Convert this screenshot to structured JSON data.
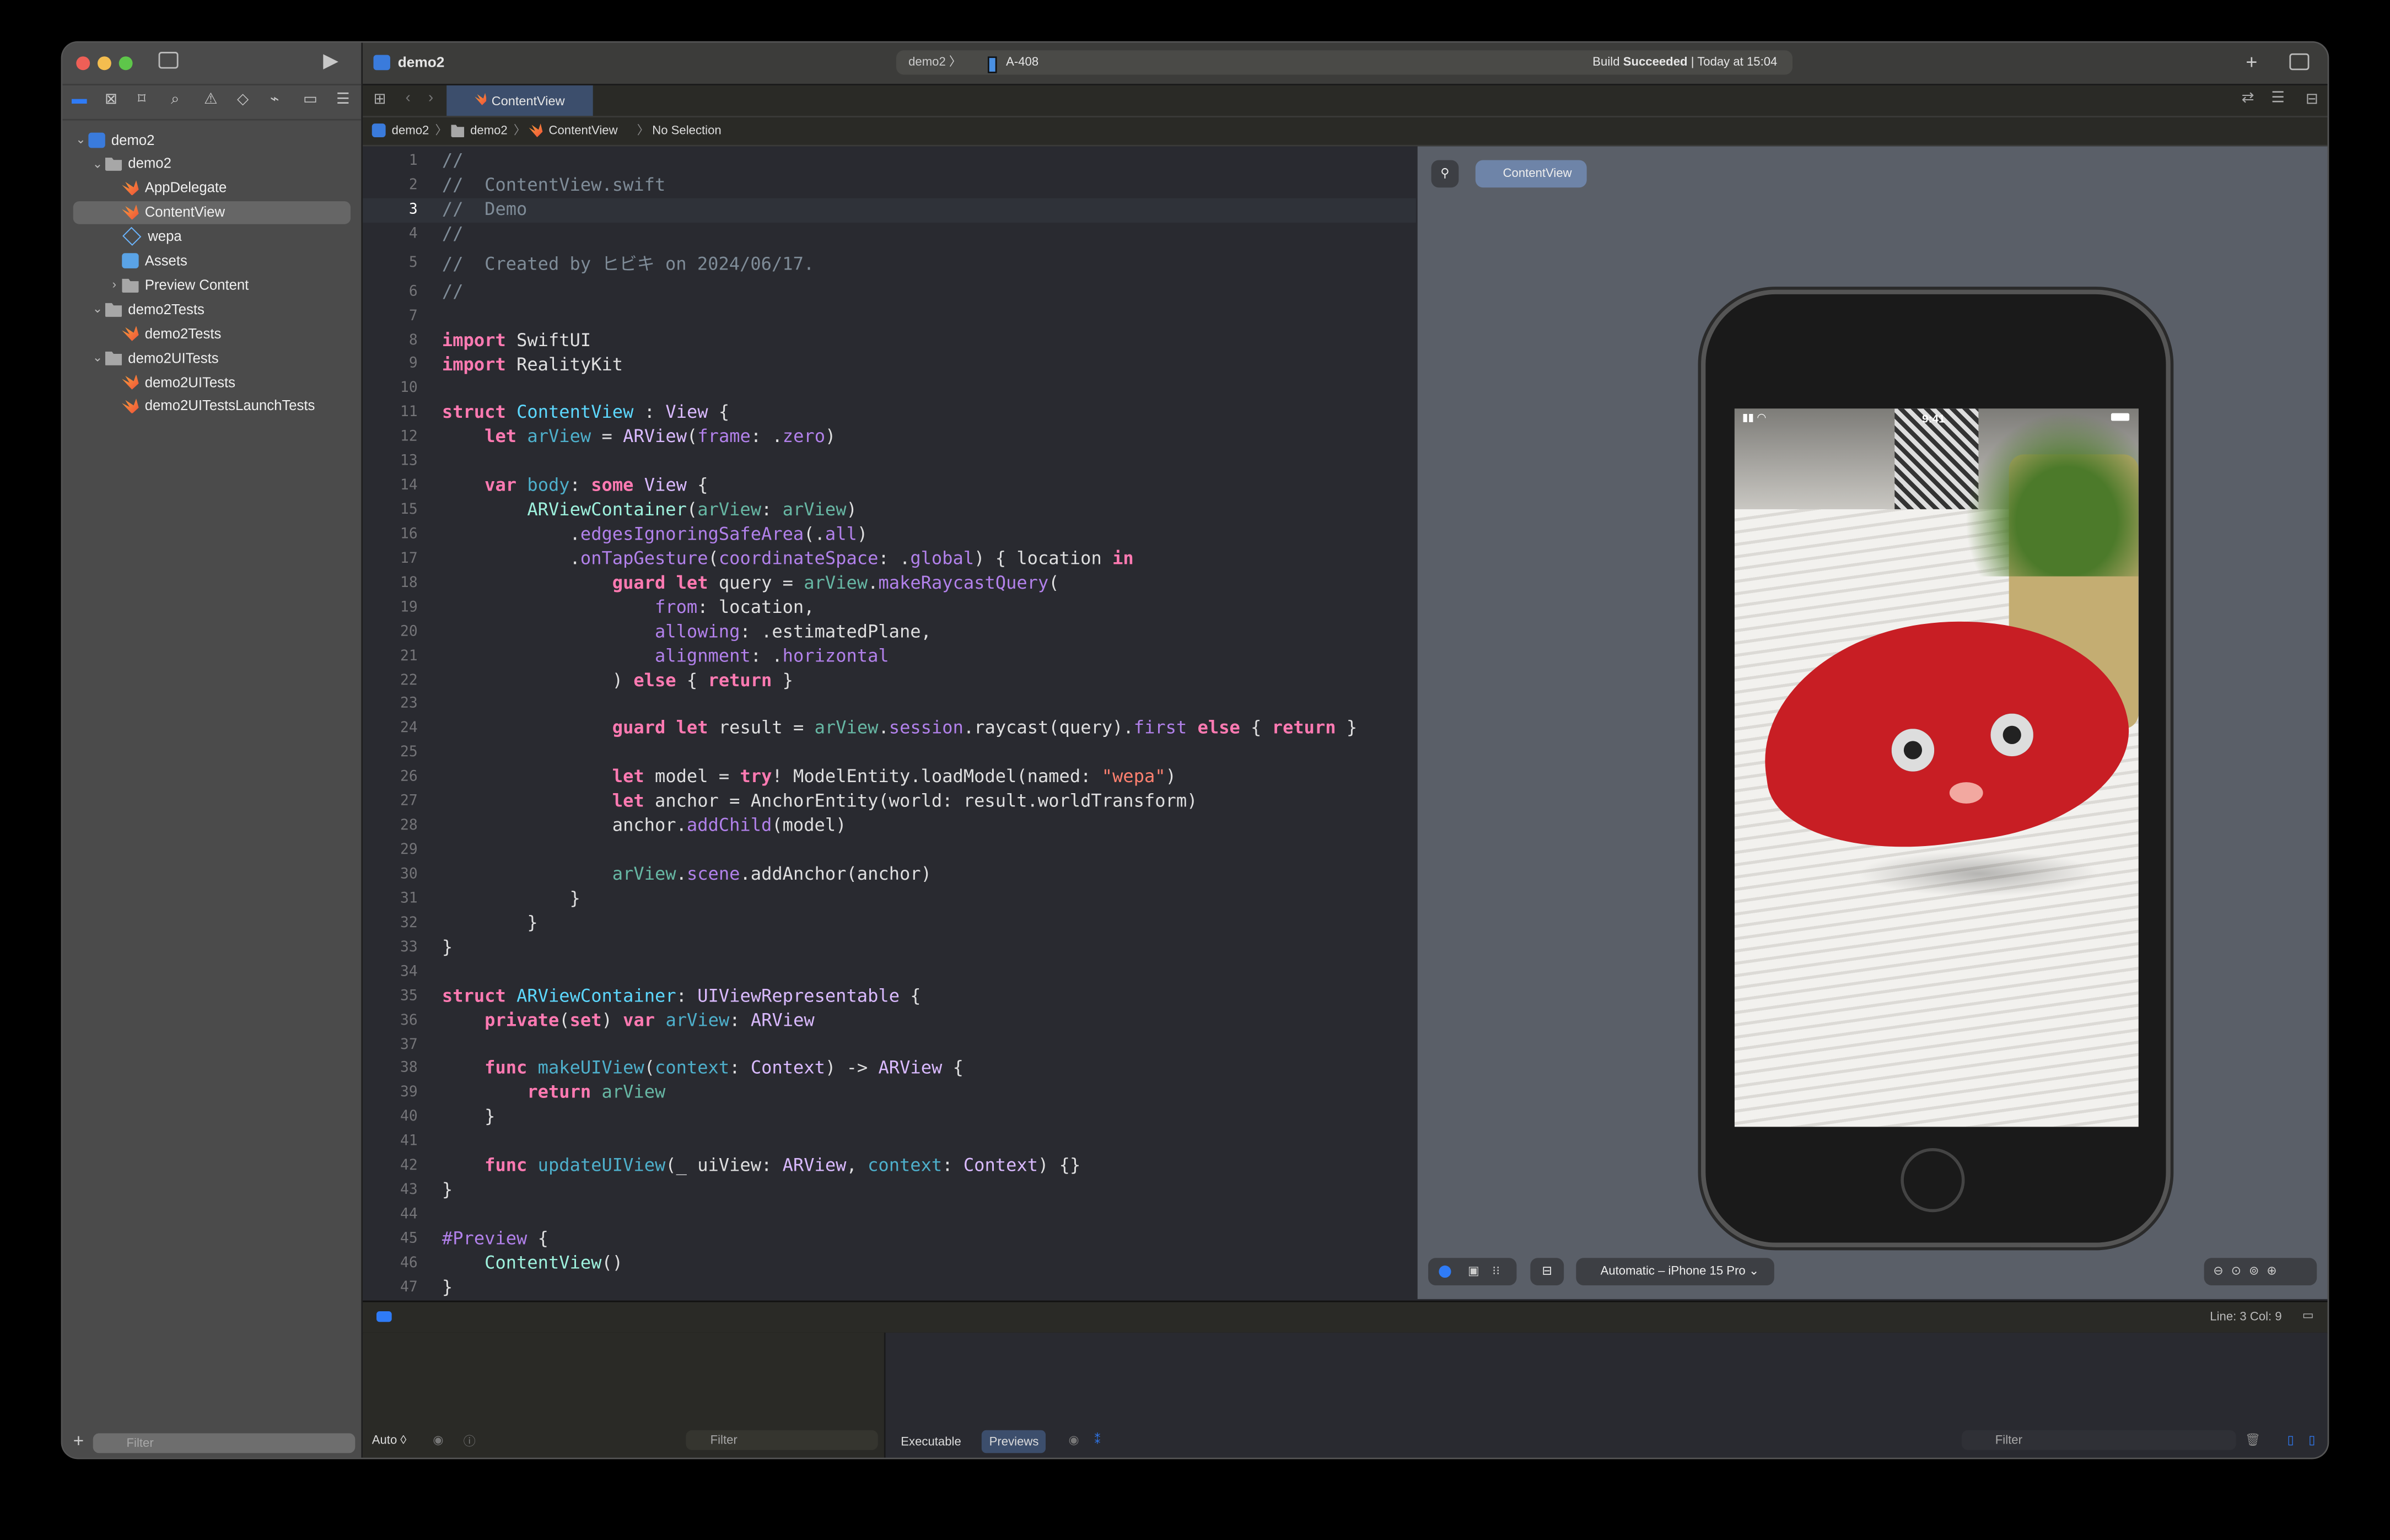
{
  "window": {
    "traffic_lights": [
      "#ee5f57",
      "#f4bd4f",
      "#5ec64a"
    ]
  },
  "toolbar": {
    "project_title": "demo2",
    "scheme": "demo2",
    "destination": "A-408",
    "status_prefix": "Build",
    "status_bold": "Succeeded",
    "status_time": "| Today at 15:04",
    "run_icon": "play-icon",
    "add_icon": "plus-icon"
  },
  "navigator": {
    "icons": [
      "folder-icon",
      "source-control-icon",
      "bookmark-icon",
      "search-icon",
      "warning-icon",
      "test-icon",
      "debug-icon",
      "breakpoint-icon",
      "report-icon"
    ],
    "items": [
      {
        "label": "demo2",
        "icon": "app",
        "level": 0,
        "chevron": "down"
      },
      {
        "label": "demo2",
        "icon": "folder",
        "level": 1,
        "chevron": "down"
      },
      {
        "label": "AppDelegate",
        "icon": "swift",
        "level": 2
      },
      {
        "label": "ContentView",
        "icon": "swift",
        "level": 2,
        "selected": true
      },
      {
        "label": "wepa",
        "icon": "cube",
        "level": 2
      },
      {
        "label": "Assets",
        "icon": "assets",
        "level": 2
      },
      {
        "label": "Preview Content",
        "icon": "folder",
        "level": 2,
        "chevron": "right"
      },
      {
        "label": "demo2Tests",
        "icon": "folder",
        "level": 1,
        "chevron": "down"
      },
      {
        "label": "demo2Tests",
        "icon": "swift",
        "level": 2
      },
      {
        "label": "demo2UITests",
        "icon": "folder",
        "level": 1,
        "chevron": "down"
      },
      {
        "label": "demo2UITests",
        "icon": "swift",
        "level": 2
      },
      {
        "label": "demo2UITestsLaunchTests",
        "icon": "swift",
        "level": 2
      }
    ],
    "filter_placeholder": "Filter"
  },
  "editor": {
    "tab": "ContentView",
    "breadcrumb": [
      "demo2",
      "demo2",
      "ContentView",
      "No Selection"
    ],
    "current_line": 3,
    "lines": [
      [
        [
          "c",
          "//"
        ]
      ],
      [
        [
          "c",
          "//  ContentView.swift"
        ]
      ],
      [
        [
          "c",
          "//  Demo"
        ]
      ],
      [
        [
          "c",
          "//"
        ]
      ],
      [
        [
          "c",
          "//  Created by ヒビキ on 2024/06/17."
        ]
      ],
      [
        [
          "c",
          "//"
        ]
      ],
      [],
      [
        [
          "k",
          "import"
        ],
        [
          "n",
          " SwiftUI"
        ]
      ],
      [
        [
          "k",
          "import"
        ],
        [
          "n",
          " RealityKit"
        ]
      ],
      [],
      [
        [
          "k",
          "struct"
        ],
        [
          "n",
          " "
        ],
        [
          "dt",
          "ContentView"
        ],
        [
          "n",
          " : "
        ],
        [
          "t",
          "View"
        ],
        [
          "n",
          " {"
        ]
      ],
      [
        [
          "n",
          "    "
        ],
        [
          "k",
          "let"
        ],
        [
          "n",
          " "
        ],
        [
          "dv",
          "arView"
        ],
        [
          "n",
          " = "
        ],
        [
          "t",
          "ARView"
        ],
        [
          "n",
          "("
        ],
        [
          "m",
          "frame"
        ],
        [
          "n",
          ": ."
        ],
        [
          "m",
          "zero"
        ],
        [
          "n",
          ")"
        ]
      ],
      [],
      [
        [
          "n",
          "    "
        ],
        [
          "k",
          "var"
        ],
        [
          "n",
          " "
        ],
        [
          "dv",
          "body"
        ],
        [
          "n",
          ": "
        ],
        [
          "k",
          "some"
        ],
        [
          "n",
          " "
        ],
        [
          "t",
          "View"
        ],
        [
          "n",
          " {"
        ]
      ],
      [
        [
          "n",
          "        "
        ],
        [
          "p",
          "ARViewContainer"
        ],
        [
          "n",
          "("
        ],
        [
          "p2",
          "arView"
        ],
        [
          "n",
          ": "
        ],
        [
          "p2",
          "arView"
        ],
        [
          "n",
          ")"
        ]
      ],
      [
        [
          "n",
          "            ."
        ],
        [
          "m",
          "edgesIgnoringSafeArea"
        ],
        [
          "n",
          "(."
        ],
        [
          "m",
          "all"
        ],
        [
          "n",
          ")"
        ]
      ],
      [
        [
          "n",
          "            ."
        ],
        [
          "m",
          "onTapGesture"
        ],
        [
          "n",
          "("
        ],
        [
          "m",
          "coordinateSpace"
        ],
        [
          "n",
          ": ."
        ],
        [
          "m",
          "global"
        ],
        [
          "n",
          ") { location "
        ],
        [
          "k",
          "in"
        ]
      ],
      [
        [
          "n",
          "                "
        ],
        [
          "k",
          "guard"
        ],
        [
          "n",
          " "
        ],
        [
          "k",
          "let"
        ],
        [
          "n",
          " query = "
        ],
        [
          "p2",
          "arView"
        ],
        [
          "n",
          "."
        ],
        [
          "m",
          "makeRaycastQuery"
        ],
        [
          "n",
          "("
        ]
      ],
      [
        [
          "n",
          "                    "
        ],
        [
          "m",
          "from"
        ],
        [
          "n",
          ": location,"
        ]
      ],
      [
        [
          "n",
          "                    "
        ],
        [
          "m",
          "allowing"
        ],
        [
          "n",
          ": .estimatedPlane,"
        ]
      ],
      [
        [
          "n",
          "                    "
        ],
        [
          "m",
          "alignment"
        ],
        [
          "n",
          ": ."
        ],
        [
          "m",
          "horizontal"
        ]
      ],
      [
        [
          "n",
          "                ) "
        ],
        [
          "k",
          "else"
        ],
        [
          "n",
          " { "
        ],
        [
          "k",
          "return"
        ],
        [
          "n",
          " }"
        ]
      ],
      [],
      [
        [
          "n",
          "                "
        ],
        [
          "k",
          "guard"
        ],
        [
          "n",
          " "
        ],
        [
          "k",
          "let"
        ],
        [
          "n",
          " result = "
        ],
        [
          "p2",
          "arView"
        ],
        [
          "n",
          "."
        ],
        [
          "m",
          "session"
        ],
        [
          "n",
          ".raycast(query)."
        ],
        [
          "m",
          "first"
        ],
        [
          "n",
          " "
        ],
        [
          "k",
          "else"
        ],
        [
          "n",
          " { "
        ],
        [
          "k",
          "return"
        ],
        [
          "n",
          " }"
        ]
      ],
      [],
      [
        [
          "n",
          "                "
        ],
        [
          "k",
          "let"
        ],
        [
          "n",
          " model = "
        ],
        [
          "k",
          "try"
        ],
        [
          "n",
          "! ModelEntity.loadModel(named: "
        ],
        [
          "s",
          "\"wepa\""
        ],
        [
          "n",
          ")"
        ]
      ],
      [
        [
          "n",
          "                "
        ],
        [
          "k",
          "let"
        ],
        [
          "n",
          " anchor = AnchorEntity(world: result.worldTransform)"
        ]
      ],
      [
        [
          "n",
          "                anchor."
        ],
        [
          "m",
          "addChild"
        ],
        [
          "n",
          "(model)"
        ]
      ],
      [],
      [
        [
          "n",
          "                "
        ],
        [
          "p2",
          "arView"
        ],
        [
          "n",
          "."
        ],
        [
          "m",
          "scene"
        ],
        [
          "n",
          ".addAnchor(anchor)"
        ]
      ],
      [
        [
          "n",
          "            }"
        ]
      ],
      [
        [
          "n",
          "        }"
        ]
      ],
      [
        [
          "n",
          "}"
        ]
      ],
      [],
      [
        [
          "k",
          "struct"
        ],
        [
          "n",
          " "
        ],
        [
          "dt",
          "ARViewContainer"
        ],
        [
          "n",
          ": "
        ],
        [
          "t",
          "UIViewRepresentable"
        ],
        [
          "n",
          " {"
        ]
      ],
      [
        [
          "n",
          "    "
        ],
        [
          "k",
          "private"
        ],
        [
          "n",
          "("
        ],
        [
          "k",
          "set"
        ],
        [
          "n",
          ") "
        ],
        [
          "k",
          "var"
        ],
        [
          "n",
          " "
        ],
        [
          "dv",
          "arView"
        ],
        [
          "n",
          ": "
        ],
        [
          "t",
          "ARView"
        ]
      ],
      [],
      [
        [
          "n",
          "    "
        ],
        [
          "k",
          "func"
        ],
        [
          "n",
          " "
        ],
        [
          "dv",
          "makeUIView"
        ],
        [
          "n",
          "("
        ],
        [
          "dv",
          "context"
        ],
        [
          "n",
          ": "
        ],
        [
          "t",
          "Context"
        ],
        [
          "n",
          ") -> "
        ],
        [
          "t",
          "ARView"
        ],
        [
          "n",
          " {"
        ]
      ],
      [
        [
          "n",
          "        "
        ],
        [
          "k",
          "return"
        ],
        [
          "n",
          " "
        ],
        [
          "p2",
          "arView"
        ]
      ],
      [
        [
          "n",
          "    }"
        ]
      ],
      [],
      [
        [
          "n",
          "    "
        ],
        [
          "k",
          "func"
        ],
        [
          "n",
          " "
        ],
        [
          "dv",
          "updateUIView"
        ],
        [
          "n",
          "(_ uiView: "
        ],
        [
          "t",
          "ARView"
        ],
        [
          "n",
          ", "
        ],
        [
          "dv",
          "context"
        ],
        [
          "n",
          ": "
        ],
        [
          "t",
          "Context"
        ],
        [
          "n",
          ") {}"
        ]
      ],
      [
        [
          "n",
          "}"
        ]
      ],
      [],
      [
        [
          "m",
          "#Preview"
        ],
        [
          "n",
          " {"
        ]
      ],
      [
        [
          "n",
          "    "
        ],
        [
          "p",
          "ContentView"
        ],
        [
          "n",
          "()"
        ]
      ],
      [
        [
          "n",
          "}"
        ]
      ]
    ]
  },
  "preview": {
    "pin_icon": "pin-icon",
    "view_label": "ContentView",
    "device_label": "Automatic – iPhone 15 Pro",
    "status_time": "9:41",
    "zoom_icons": [
      "zoom-out-icon",
      "zoom-fit-icon",
      "zoom-100-icon",
      "zoom-in-icon"
    ]
  },
  "status": {
    "line_col": "Line: 3  Col: 9"
  },
  "debug_area": {
    "variables_mode": "Auto ◊",
    "filter_placeholder": "Filter",
    "console_tabs": [
      "Executable",
      "Previews"
    ],
    "active_console_tab": "Previews"
  }
}
